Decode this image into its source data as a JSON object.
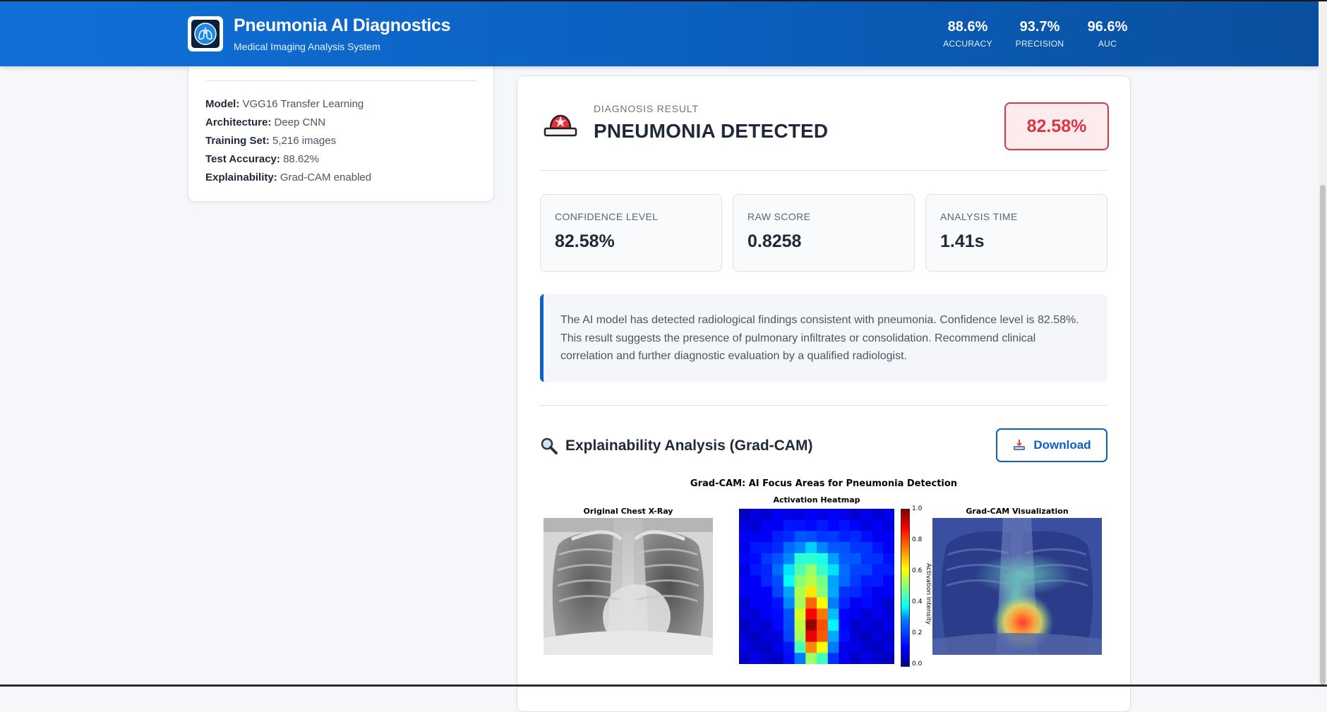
{
  "header": {
    "title": "Pneumonia AI Diagnostics",
    "subtitle": "Medical Imaging Analysis System",
    "logo_icon": "lungs-icon",
    "metrics": [
      {
        "value": "88.6%",
        "label": "ACCURACY"
      },
      {
        "value": "93.7%",
        "label": "PRECISION"
      },
      {
        "value": "96.6%",
        "label": "AUC"
      }
    ],
    "colors": {
      "gradient_start": "#1070d8",
      "gradient_end": "#0a4f9e"
    }
  },
  "model_info": {
    "items": [
      {
        "key": "Model:",
        "value": "VGG16 Transfer Learning"
      },
      {
        "key": "Architecture:",
        "value": "Deep CNN"
      },
      {
        "key": "Training Set:",
        "value": "5,216 images"
      },
      {
        "key": "Test Accuracy:",
        "value": "88.62%"
      },
      {
        "key": "Explainability:",
        "value": "Grad-CAM enabled"
      }
    ]
  },
  "result": {
    "label": "DIAGNOSIS RESULT",
    "title": "PNEUMONIA DETECTED",
    "badge": "82.58%",
    "icon": "siren-icon",
    "accent_color": "#dc3545",
    "stats": [
      {
        "label": "CONFIDENCE LEVEL",
        "value": "82.58%"
      },
      {
        "label": "RAW SCORE",
        "value": "0.8258"
      },
      {
        "label": "ANALYSIS TIME",
        "value": "1.41s"
      }
    ],
    "note": "The AI model has detected radiological findings consistent with pneumonia. Confidence level is 82.58%. This result suggests the presence of pulmonary infiltrates or consolidation. Recommend clinical correlation and further diagnostic evaluation by a qualified radiologist."
  },
  "explainability": {
    "title": "Explainability Analysis (Grad-CAM)",
    "icon": "magnifier-icon",
    "download_label": "Download",
    "download_icon": "download-tray-icon",
    "figure": {
      "title": "Grad-CAM: AI Focus Areas for Pneumonia Detection",
      "panels": [
        "Original Chest X-Ray",
        "Activation Heatmap",
        "Grad-CAM Visualization"
      ],
      "colorbar_label": "Activation Intensity",
      "colorbar_ticks": [
        "1.0",
        "0.8",
        "0.6",
        "0.4",
        "0.2",
        "0.0"
      ]
    }
  }
}
